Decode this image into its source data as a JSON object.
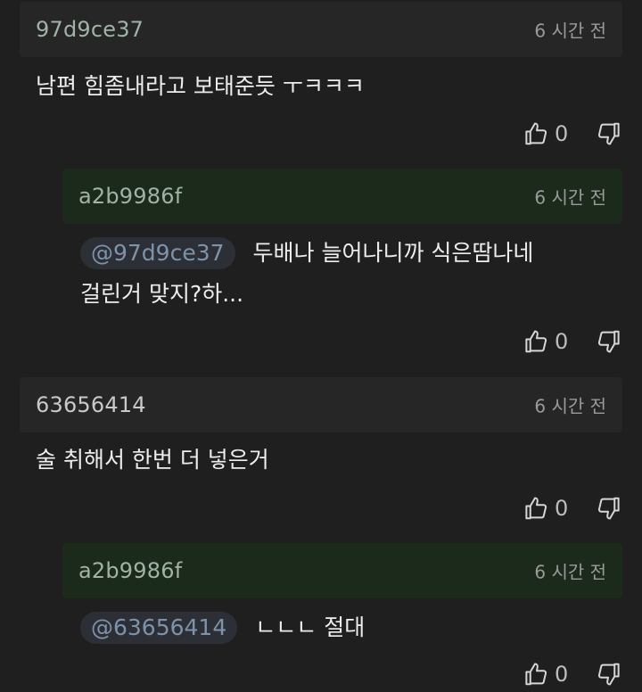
{
  "comments": [
    {
      "author": "97d9ce37",
      "time": "6 시간 전",
      "text": "남편 힘좀내라고 보태준듯 ㅜㅋㅋㅋ",
      "likes": "0"
    },
    {
      "author": "a2b9986f",
      "time": "6 시간 전",
      "mention": "@97d9ce37",
      "text_line1": "두배나 늘어나니까 식은땀나네",
      "text_line2": "걸린거 맞지?하...",
      "likes": "0"
    },
    {
      "author": "63656414",
      "time": "6 시간 전",
      "text": "술 취해서 한번 더 넣은거",
      "likes": "0"
    },
    {
      "author": "a2b9986f",
      "time": "6 시간 전",
      "mention": "@63656414",
      "text": "ㄴㄴㄴ 절대",
      "likes": "0"
    }
  ],
  "icons": {
    "like": "thumbs-up-icon",
    "dislike": "thumbs-down-icon"
  },
  "colors": {
    "background": "#1f1f1f",
    "comment_header": "#262626",
    "reply_header": "#1c2a1b",
    "author": "#9fb3a6",
    "mention_text": "#7e92a9",
    "mention_bg": "#2c3036"
  }
}
